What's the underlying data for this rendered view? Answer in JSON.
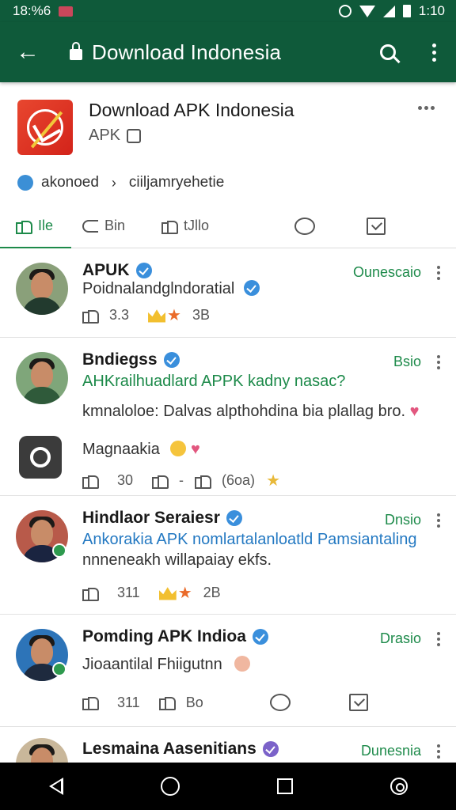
{
  "status_bar": {
    "left_text": "18:%6",
    "time": "1:10"
  },
  "toolbar": {
    "title": "Download Indonesia"
  },
  "page": {
    "name": "Download APK Indonesia",
    "sub": "APK"
  },
  "breadcrumb": {
    "item": "akonoed",
    "current": "ciiljamryehetie"
  },
  "tabs": [
    {
      "label": "Ile",
      "icon": "thumbs-up-icon"
    },
    {
      "label": "Bin",
      "icon": "reply-icon"
    },
    {
      "label": "tJllo",
      "icon": "thumbs-up-icon"
    },
    {
      "label": "",
      "icon": "comment-icon"
    },
    {
      "label": "",
      "icon": "checkbox-icon"
    }
  ],
  "posts": [
    {
      "name": "APUK",
      "time": "Ounescaio",
      "lines": [
        "Poidnalandglndoratial"
      ],
      "likes": "3.3",
      "reactions": "3B"
    },
    {
      "name": "Bndiegss",
      "time": "Bsio",
      "lines": [
        "AHKrailhuadlard APPK kadny nasac?",
        "kmnaloloe: Dalvas alpthohdina bia plallag bro.",
        "Magnaakia"
      ],
      "likes": "30",
      "extra": "(6oa)"
    },
    {
      "name": "Hindlaor Seraiesr",
      "time": "Dnsio",
      "lines": [
        "Ankorakia APK nomlartalanloatld Pamsiantaling",
        "nnneneakh willapaiay ekfs."
      ],
      "likes": "311",
      "reactions": "2B"
    },
    {
      "name": "Pomding APK Indioa",
      "time": "Drasio",
      "lines": [
        "Jioaantilal Fhiigutnn"
      ],
      "likes": "311",
      "reactions": "Bo"
    },
    {
      "name": "Lesmaina Aasenitians",
      "time": "Dunesnia",
      "lines": []
    }
  ]
}
